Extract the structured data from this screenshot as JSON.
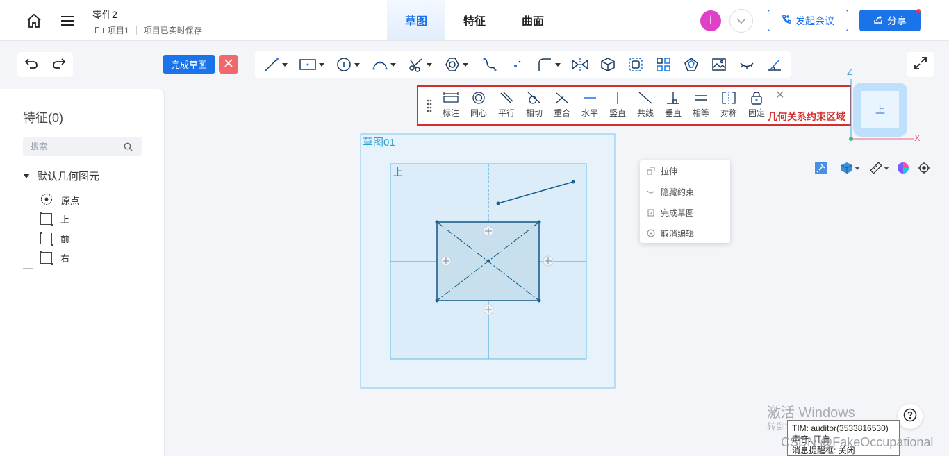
{
  "header": {
    "doc_title": "零件2",
    "project": "项目1",
    "save_status": "项目已实时保存",
    "tabs": [
      {
        "label": "草图",
        "active": true
      },
      {
        "label": "特征",
        "active": false
      },
      {
        "label": "曲面",
        "active": false
      }
    ],
    "avatar_letter": "i",
    "meeting_label": "发起会议",
    "share_label": "分享"
  },
  "toolbar": {
    "finish_sketch_label": "完成草图"
  },
  "left_panel": {
    "title": "特征(0)",
    "search_placeholder": "搜索",
    "tree_root": "默认几何图元",
    "items": [
      "原点",
      "上",
      "前",
      "右"
    ]
  },
  "constraints": {
    "items": [
      "标注",
      "同心",
      "平行",
      "相切",
      "重合",
      "水平",
      "竖直",
      "共线",
      "垂直",
      "相等",
      "对称",
      "固定"
    ],
    "annotation": "几何关系约束区域"
  },
  "view_cube": {
    "face": "上",
    "axis_z": "Z",
    "axis_x": "X"
  },
  "canvas": {
    "sketch_name": "草图01",
    "plane_name": "上"
  },
  "context_menu": {
    "items": [
      "拉伸",
      "隐藏约束",
      "完成草图",
      "取消编辑"
    ]
  },
  "watermark": {
    "line1": "激活 Windows",
    "line2": "转到“设置”以激活 Windows。",
    "csdn": "CSDN @FakeOccupational"
  },
  "tooltip": {
    "line1": "TIM: auditor(3533816530)",
    "line2": "声音: 开启",
    "line3": "消息提醒框: 关闭"
  },
  "colors": {
    "accent": "#1a73e8",
    "cancel": "#f0686b",
    "annotation_red": "#d32f2f",
    "sketch_stroke": "#1b5f8c",
    "avatar": "#e040c8"
  }
}
